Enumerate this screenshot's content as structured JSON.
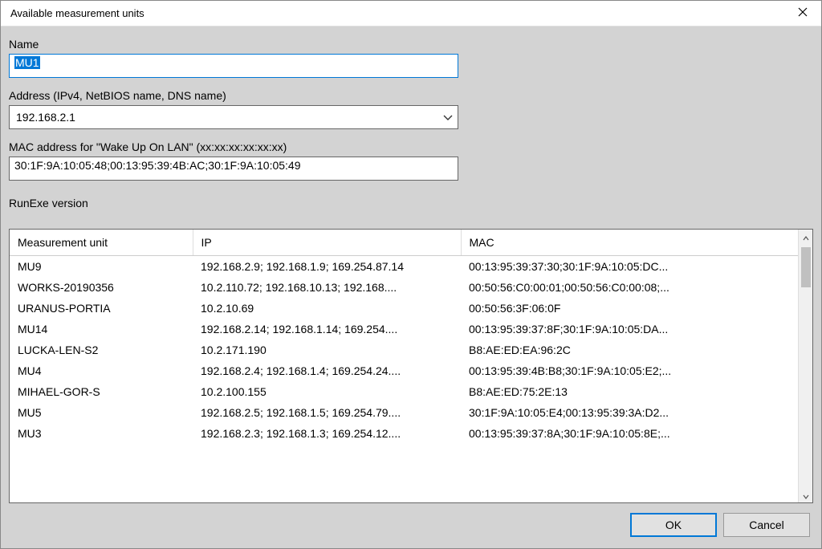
{
  "window": {
    "title": "Available measurement units"
  },
  "fields": {
    "name_label": "Name",
    "name_value": "MU1",
    "address_label": "Address (IPv4, NetBIOS name, DNS name)",
    "address_value": "192.168.2.1",
    "mac_label": "MAC address for \"Wake Up On LAN\" (xx:xx:xx:xx:xx:xx)",
    "mac_value": "30:1F:9A:10:05:48;00:13:95:39:4B:AC;30:1F:9A:10:05:49",
    "runexe_label": "RunExe version",
    "runexe_value": ""
  },
  "table": {
    "headers": {
      "mu": "Measurement unit",
      "ip": "IP",
      "mac": "MAC"
    },
    "rows": [
      {
        "mu": "MU9",
        "ip": "192.168.2.9; 192.168.1.9; 169.254.87.14",
        "mac": "00:13:95:39:37:30;30:1F:9A:10:05:DC..."
      },
      {
        "mu": "WORKS-20190356",
        "ip": "10.2.110.72; 192.168.10.13; 192.168....",
        "mac": "00:50:56:C0:00:01;00:50:56:C0:00:08;..."
      },
      {
        "mu": "URANUS-PORTIA",
        "ip": "10.2.10.69",
        "mac": "00:50:56:3F:06:0F"
      },
      {
        "mu": "MU14",
        "ip": "192.168.2.14; 192.168.1.14; 169.254....",
        "mac": "00:13:95:39:37:8F;30:1F:9A:10:05:DA..."
      },
      {
        "mu": "LUCKA-LEN-S2",
        "ip": "10.2.171.190",
        "mac": "B8:AE:ED:EA:96:2C"
      },
      {
        "mu": "MU4",
        "ip": "192.168.2.4; 192.168.1.4; 169.254.24....",
        "mac": "00:13:95:39:4B:B8;30:1F:9A:10:05:E2;..."
      },
      {
        "mu": "MIHAEL-GOR-S",
        "ip": "10.2.100.155",
        "mac": "B8:AE:ED:75:2E:13"
      },
      {
        "mu": "MU5",
        "ip": "192.168.2.5; 192.168.1.5; 169.254.79....",
        "mac": "30:1F:9A:10:05:E4;00:13:95:39:3A:D2..."
      },
      {
        "mu": "MU3",
        "ip": "192.168.2.3; 192.168.1.3; 169.254.12....",
        "mac": "00:13:95:39:37:8A;30:1F:9A:10:05:8E;..."
      }
    ]
  },
  "buttons": {
    "ok": "OK",
    "cancel": "Cancel"
  }
}
